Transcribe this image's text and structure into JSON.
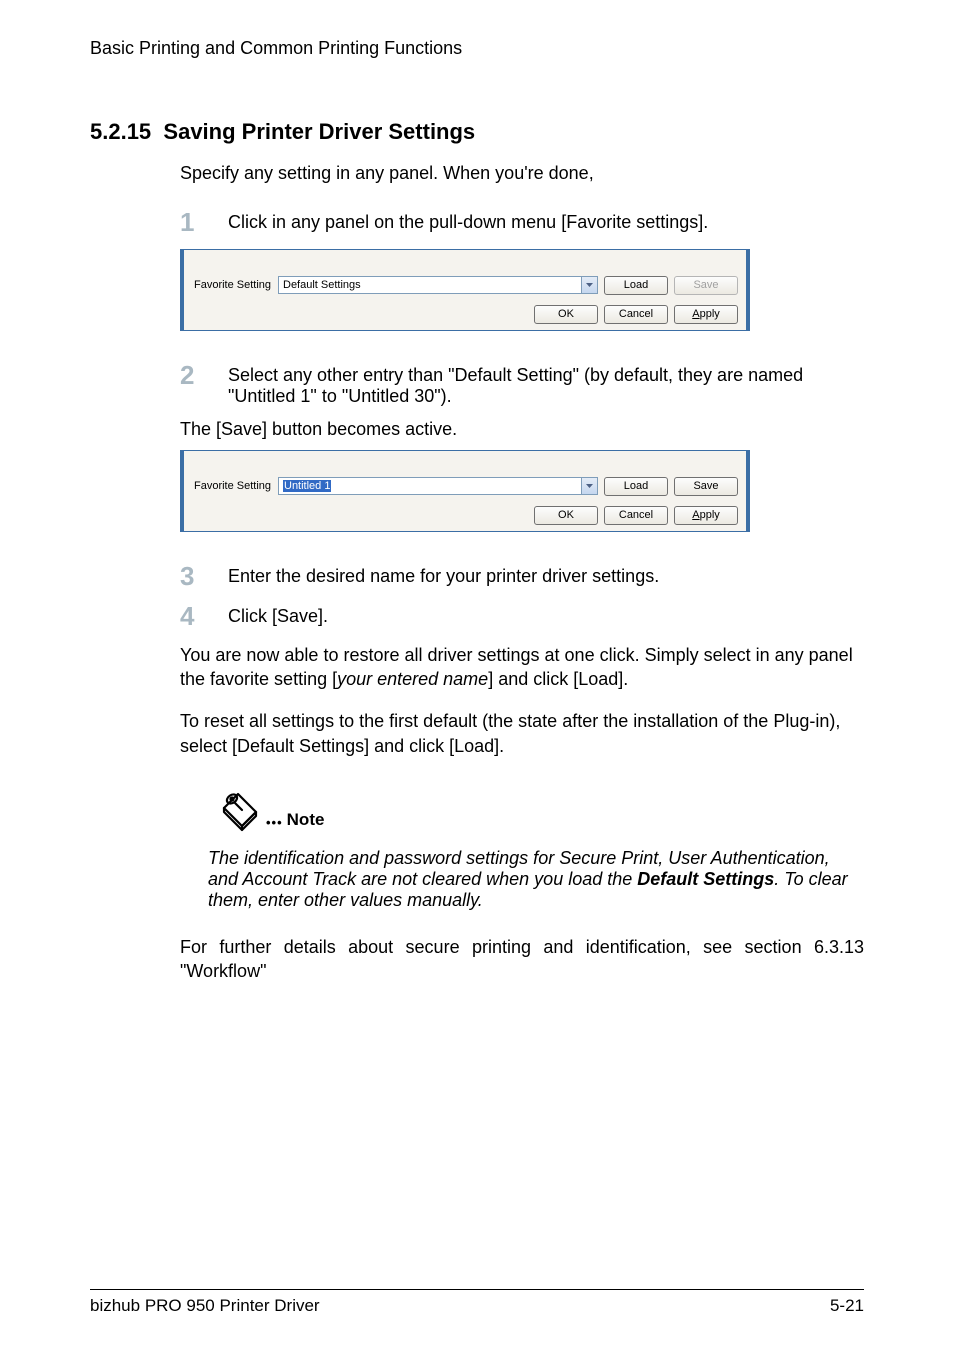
{
  "runningHeader": "Basic Printing and Common Printing Functions",
  "section": {
    "number": "5.2.15",
    "title": "Saving Printer Driver Settings"
  },
  "intro": "Specify any setting in any panel. When you're done,",
  "steps": {
    "s1": {
      "num": "1",
      "text": "Click in any panel on the pull-down menu [Favorite settings]."
    },
    "s2": {
      "num": "2",
      "text": "Select any other entry than \"Default Setting\" (by default, they are named \"Untitled 1\" to \"Untitled 30\")."
    },
    "s3": {
      "num": "3",
      "text": "Enter the desired name for your printer driver settings."
    },
    "s4": {
      "num": "4",
      "text": "Click [Save]."
    }
  },
  "afterStep2": "The [Save] button becomes active.",
  "screenshot1": {
    "label": "Favorite Setting",
    "comboValue": "Default Settings",
    "load": "Load",
    "save": "Save",
    "ok": "OK",
    "cancel": "Cancel",
    "applyPrefix": "A",
    "applyRest": "pply"
  },
  "screenshot2": {
    "label": "Favorite Setting",
    "comboValue": "Untitled 1",
    "load": "Load",
    "save": "Save",
    "ok": "OK",
    "cancel": "Cancel",
    "applyPrefix": "A",
    "applyRest": "pply"
  },
  "para1a": "You are now able to restore all driver settings at one click. Simply select in any panel the favorite setting [",
  "para1b": "your entered name",
  "para1c": "] and click [Load].",
  "para2": "To reset all settings to the first default (the state after the installation of the Plug-in), select [Default Settings] and click [Load].",
  "note": {
    "label": "Note",
    "textA": "The identification and password settings for Secure Print, User Authentication, and Account Track are not cleared when you load the ",
    "textBold": "Default Settings",
    "textB": ". To clear them, enter other values manually."
  },
  "para3": "For further details about secure printing and identification, see section 6.3.13 \"Workflow\"",
  "footer": {
    "left": "bizhub PRO 950 Printer Driver",
    "right": "5-21"
  }
}
